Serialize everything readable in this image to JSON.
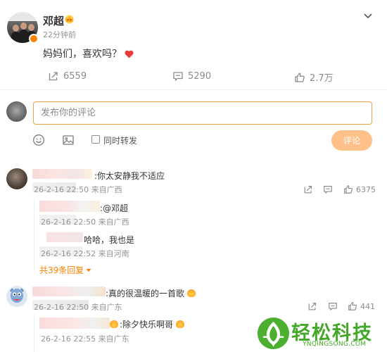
{
  "post": {
    "author": "邓超",
    "time": "22分钟前",
    "text": "妈妈们，喜欢吗？",
    "repost_count": "6559",
    "comment_count": "5290",
    "like_count": "2.7万"
  },
  "composer": {
    "placeholder": "发布你的评论",
    "repost_label": "同时转发",
    "submit_label": "评论"
  },
  "comments": [
    {
      "text": ":你太安静我不适应",
      "time_location": "26-2-16 22:50 来自广西",
      "like_count": "6375",
      "replies": [
        {
          "text": ":@邓超",
          "time_location": "26-2-16 22:50 来自广西"
        },
        {
          "text": "哈哈，我也是",
          "time_location": "26-2-16 22:52 来自河南"
        }
      ],
      "more_replies": "共39条回复"
    },
    {
      "text": ":真的很温暖的一首歌",
      "time_location": "26-2-16 22:50 来自广东",
      "like_count": "441",
      "replies": [
        {
          "text": ":除夕快乐啊哥",
          "time_location": "26-2-16 22:55 来自广东"
        }
      ]
    }
  ],
  "watermark": {
    "title": "轻松科技",
    "subtitle": "YNQINGSONG.COM"
  },
  "colors": {
    "accent": "#ff8200",
    "input_border": "#f0a04b",
    "submit_disabled": "#ffc08a",
    "heart": "#e83b35",
    "watermark_green": "#43a827"
  }
}
